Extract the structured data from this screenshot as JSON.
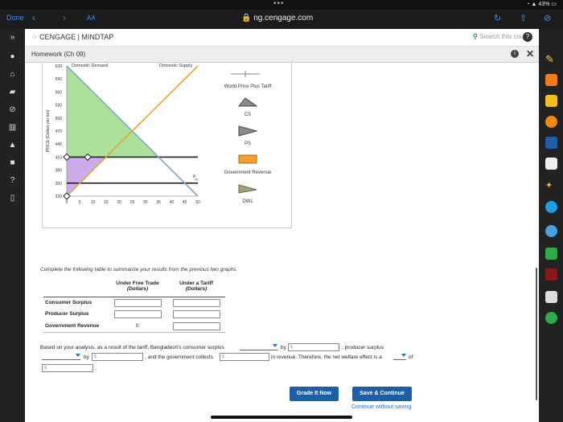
{
  "browser": {
    "done": "Done",
    "aa": "AA",
    "url": "ng.cengage.com",
    "battery": "43%"
  },
  "header": {
    "brand": "CENGAGE",
    "product": "MINDTAP",
    "search_placeholder": "Search this course",
    "help": "?"
  },
  "subheader": {
    "title": "Homework (Ch 09)"
  },
  "chart_data": {
    "type": "line",
    "xlabel": "QUANTITY (Tons of maize)",
    "ylabel": "PRICE (Dollars per ton)",
    "x_ticks": [
      0,
      5,
      10,
      15,
      20,
      25,
      30,
      35,
      40,
      45,
      50
    ],
    "y_ticks": [
      320,
      350,
      380,
      410,
      440,
      470,
      500,
      530,
      560,
      590,
      620
    ],
    "xlim": [
      0,
      50
    ],
    "ylim": [
      320,
      620
    ],
    "series": [
      {
        "name": "Domestic Demand",
        "color": "#7aaad0",
        "points": [
          [
            0,
            620
          ],
          [
            50,
            320
          ]
        ]
      },
      {
        "name": "Domestic Supply",
        "color": "#f0a030",
        "points": [
          [
            0,
            320
          ],
          [
            50,
            620
          ]
        ]
      }
    ],
    "horizontal_lines": [
      {
        "y": 410,
        "color": "#222",
        "handles_x": [
          0,
          8
        ]
      },
      {
        "y": 350,
        "color": "#222",
        "label": "Pw"
      }
    ],
    "shaded_regions": [
      {
        "name": "CS",
        "color": "#9ddc8a",
        "polygon": [
          [
            0,
            620
          ],
          [
            0,
            410
          ],
          [
            35,
            410
          ]
        ]
      },
      {
        "name": "PS",
        "color": "#c39ee6",
        "polygon": [
          [
            0,
            410
          ],
          [
            0,
            320
          ],
          [
            15,
            410
          ]
        ]
      }
    ],
    "labels": {
      "demand": "Domestic Demand",
      "supply": "Domestic Supply",
      "pw": "P",
      "pw_sub": "W"
    }
  },
  "legend": [
    {
      "label": "World Price Plus Tariff",
      "icon": "cross-line-icon"
    },
    {
      "label": "CS",
      "icon": "triangle-icon"
    },
    {
      "label": "PS",
      "icon": "triangle-icon"
    },
    {
      "label": "Government Revenue",
      "icon": "rectangle-icon"
    },
    {
      "label": "DWL",
      "icon": "triangle-icon"
    }
  ],
  "table": {
    "instruction": "Complete the following table to summarize your results from the previous two graphs.",
    "col1": "Under Free Trade",
    "col1_sub": "(Dollars)",
    "col2": "Under a Tariff",
    "col2_sub": "(Dollars)",
    "rows": [
      {
        "label": "Consumer Surplus",
        "free": "",
        "tariff": ""
      },
      {
        "label": "Producer Surplus",
        "free": "",
        "tariff": ""
      },
      {
        "label": "Government Revenue",
        "free": "0",
        "tariff": ""
      }
    ]
  },
  "analysis": {
    "p1": "Based on your analysis, as a result of the tariff, Bangladesh's consumer surplus",
    "by": "by",
    "p2": ", producer surplus",
    "p3": ", and the government collects",
    "p4": "in revenue. Therefore, the net welfare effect is a",
    "of": "of",
    "dollar": "$",
    "end": "."
  },
  "buttons": {
    "grade": "Grade It Now",
    "save": "Save & Continue",
    "continue": "Continue without saving"
  }
}
